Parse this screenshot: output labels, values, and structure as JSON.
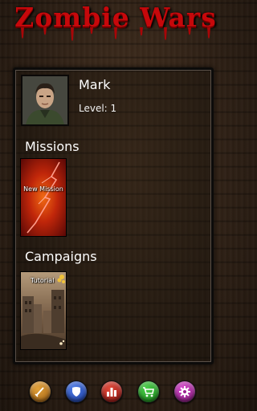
{
  "app": {
    "title": "Zombie Wars"
  },
  "colors": {
    "title_red": "#c6080b",
    "panel_border": "#0c0b0a"
  },
  "player": {
    "name": "Mark",
    "level_text": "Level: 1",
    "avatar_icon": "soldier-portrait"
  },
  "missions": {
    "section_title": "Missions",
    "items": [
      {
        "label": "New Mission",
        "icon": "lightning-red-thumbnail"
      }
    ]
  },
  "campaigns": {
    "section_title": "Campaigns",
    "items": [
      {
        "label": "Tutorial",
        "icon": "ruined-city-thumbnail"
      }
    ]
  },
  "toolbar": {
    "buttons": [
      {
        "icon": "sword-icon",
        "color": "#d08a22"
      },
      {
        "icon": "shield-icon",
        "color": "#2a55c8"
      },
      {
        "icon": "leaderboard-icon",
        "color": "#c42a20"
      },
      {
        "icon": "shop-cart-icon",
        "color": "#2fa82f"
      },
      {
        "icon": "settings-gear-icon",
        "color": "#b82aa8"
      }
    ]
  }
}
